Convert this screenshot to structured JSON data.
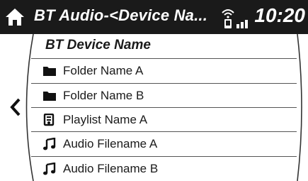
{
  "statusbar": {
    "title": "BT Audio-<Device Na...",
    "time": "10:20",
    "home_icon": "home-icon",
    "signal_icons": [
      "wifi-phone-icon",
      "signal-strength-icon"
    ]
  },
  "list": {
    "header": "BT Device Name",
    "items": [
      {
        "label": "Folder Name A",
        "icon": "folder-icon"
      },
      {
        "label": "Folder Name B",
        "icon": "folder-icon"
      },
      {
        "label": "Playlist Name A",
        "icon": "playlist-icon"
      },
      {
        "label": "Audio Filename A",
        "icon": "music-note-icon"
      },
      {
        "label": "Audio Filename B",
        "icon": "music-note-icon"
      }
    ]
  },
  "nav": {
    "back_icon": "chevron-left-icon"
  },
  "colors": {
    "statusbar_bg": "#1a1a1a",
    "text": "#1a1a1a",
    "background": "#ffffff"
  }
}
